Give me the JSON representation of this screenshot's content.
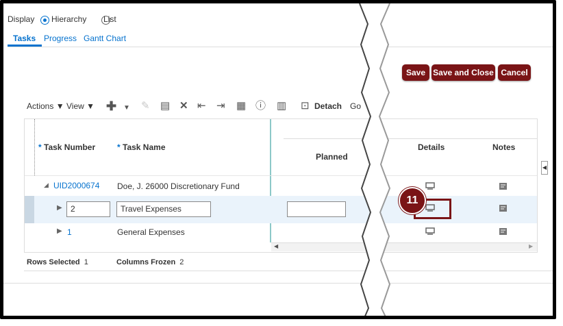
{
  "display": {
    "label": "Display",
    "options": [
      {
        "label": "Hierarchy",
        "selected": true
      },
      {
        "label": "List",
        "selected": false
      }
    ]
  },
  "tabs": [
    {
      "label": "Tasks",
      "active": true
    },
    {
      "label": "Progress",
      "active": false
    },
    {
      "label": "Gantt Chart",
      "active": false
    }
  ],
  "buttons": {
    "save": "Save",
    "save_close": "Save and Close",
    "cancel": "Cancel"
  },
  "toolbar": {
    "actions": "Actions",
    "view": "View",
    "detach": "Detach",
    "go": "Go"
  },
  "grid": {
    "headers": {
      "task_number": "Task Number",
      "task_name": "Task Name",
      "planned": "Planned",
      "details": "Details",
      "notes": "Notes",
      "required_marker": "*"
    },
    "rows": [
      {
        "task_number": "UID2000674",
        "task_name": "Doe, J. 26000 Discretionary Fund",
        "expanded": true
      },
      {
        "task_number": "2",
        "task_name": "Travel Expenses",
        "selected": true,
        "editing": true
      },
      {
        "task_number": "1",
        "task_name": "General Expenses"
      }
    ]
  },
  "status": {
    "rows_selected_label": "Rows Selected",
    "rows_selected_value": "1",
    "columns_frozen_label": "Columns Frozen",
    "columns_frozen_value": "2"
  },
  "callout": {
    "step": "11"
  },
  "colors": {
    "accent": "#0572ce",
    "button": "#7a1416",
    "selected_row": "#eaf3fb"
  }
}
